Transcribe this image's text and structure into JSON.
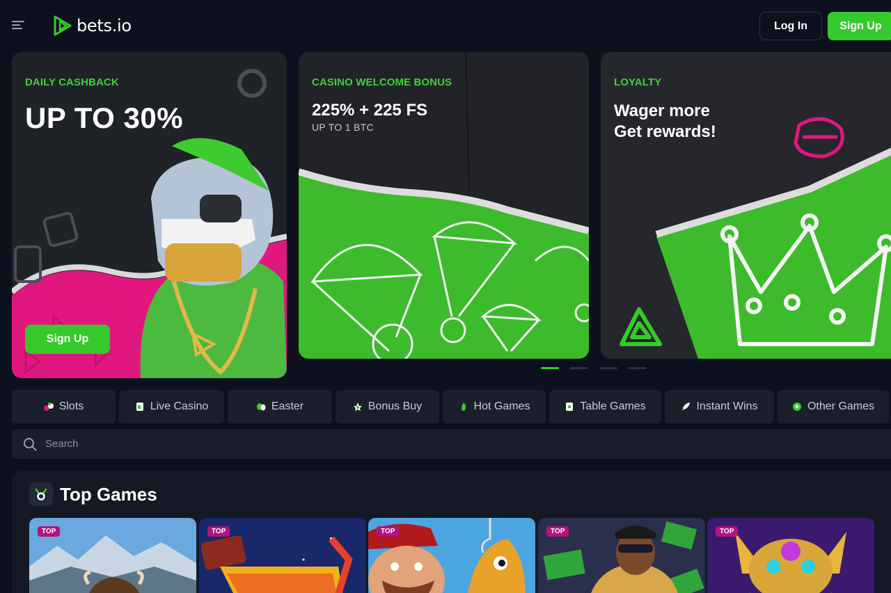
{
  "header": {
    "logo_text": "bets.io",
    "login_label": "Log In",
    "signup_label": "Sign Up"
  },
  "banners": [
    {
      "tag": "DAILY CASHBACK",
      "title": "UP TO 30%",
      "button_label": "Sign Up"
    },
    {
      "tag": "CASINO WELCOME BONUS",
      "title": "225% + 225 FS",
      "subtitle": "UP TO 1 BTC"
    },
    {
      "tag": "LOYALTY",
      "title_line1": "Wager more",
      "title_line2": "Get rewards!"
    }
  ],
  "carousel": {
    "slide_count": 4,
    "active_index": 0
  },
  "categories": [
    {
      "label": "Slots",
      "icon": "slots-icon"
    },
    {
      "label": "Live Casino",
      "icon": "live-casino-icon"
    },
    {
      "label": "Easter",
      "icon": "easter-icon"
    },
    {
      "label": "Bonus Buy",
      "icon": "bonus-buy-icon"
    },
    {
      "label": "Hot Games",
      "icon": "fire-icon"
    },
    {
      "label": "Table Games",
      "icon": "table-games-icon"
    },
    {
      "label": "Instant Wins",
      "icon": "rocket-icon"
    },
    {
      "label": "Other Games",
      "icon": "other-games-icon"
    }
  ],
  "search": {
    "placeholder": "Search"
  },
  "top_games": {
    "title": "Top Games",
    "badge": "TOP",
    "games": [
      {
        "badge": "TOP"
      },
      {
        "badge": "TOP"
      },
      {
        "badge": "TOP"
      },
      {
        "badge": "TOP"
      },
      {
        "badge": "TOP"
      }
    ]
  },
  "colors": {
    "background": "#0c111d",
    "accent_green": "#36c92b",
    "tag_green": "#3ed136",
    "pink": "#e0177f",
    "panel": "#1a1f2b"
  }
}
